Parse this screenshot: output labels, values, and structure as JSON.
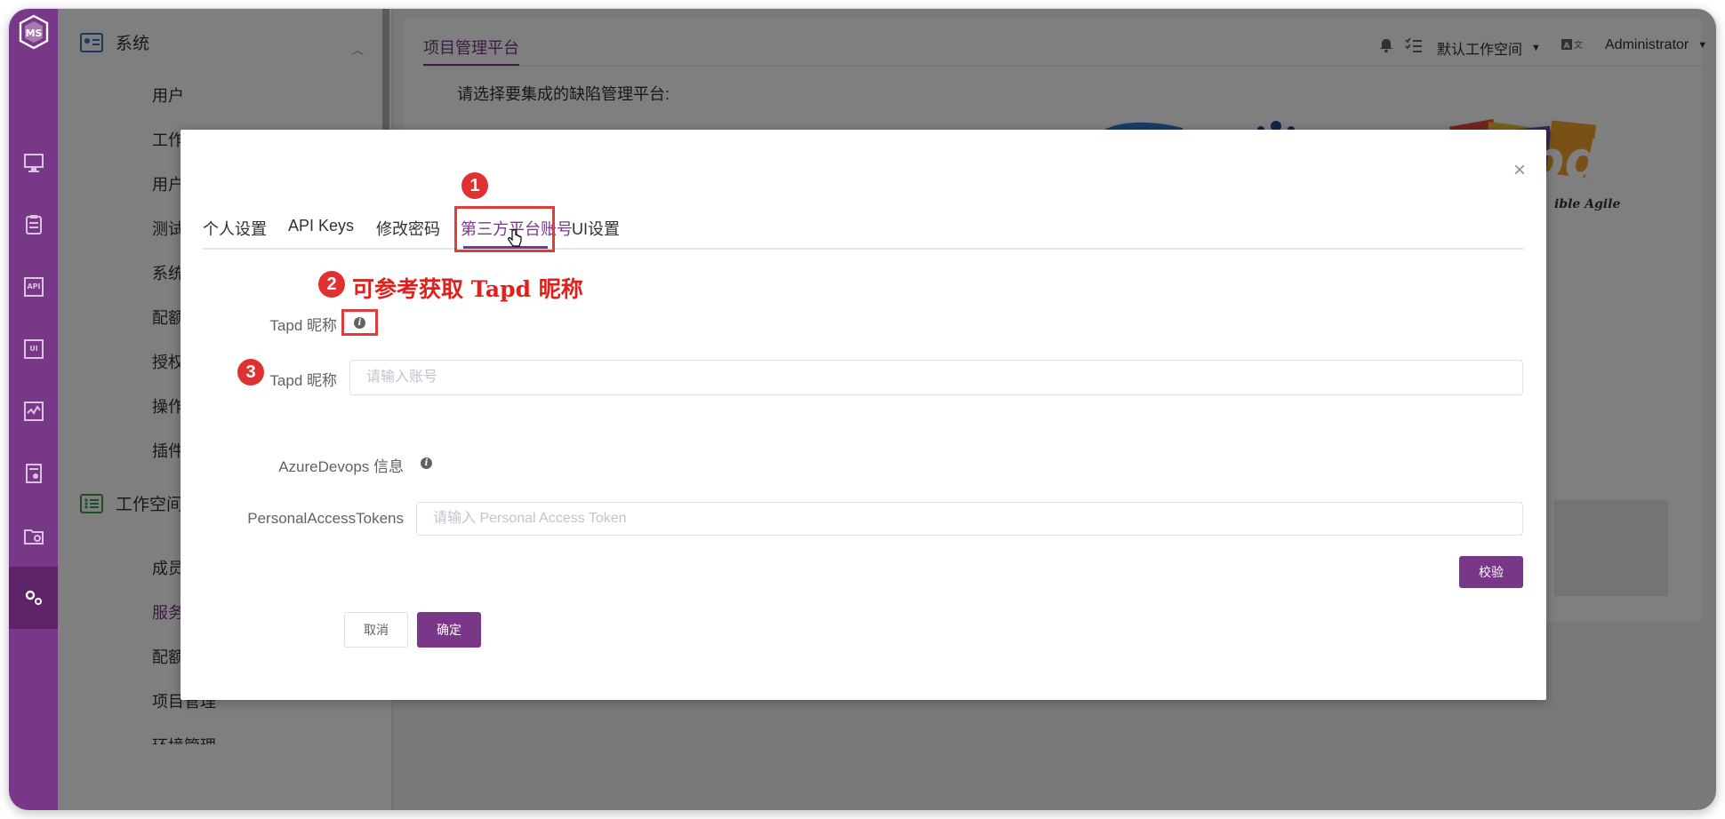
{
  "sidebar": {
    "groups": [
      {
        "label": "系统"
      },
      {
        "label": "工作空间"
      }
    ],
    "system_items": [
      "用户",
      "工作空间",
      "用户组与权",
      "测试资源池",
      "系统参数设",
      "配额管理",
      "授权管理",
      "操作日志",
      "插件管理"
    ],
    "workspace_items": [
      "成员",
      "服务集成",
      "配额管理",
      "项目管理",
      "环境管理"
    ]
  },
  "header": {
    "tab_title": "项目管理平台",
    "prompt": "请选择要集成的缺陷管理平台:",
    "workspace": "默认工作空间",
    "user": "Administrator",
    "tapd_slogan": "ible Agile"
  },
  "dialog": {
    "tabs": [
      "个人设置",
      "API Keys",
      "修改密码",
      "第三方平台账号",
      "UI设置"
    ],
    "active_tab": 3,
    "annotation": "可参考获取 Tapd 昵称",
    "badges": [
      "1",
      "2",
      "3"
    ],
    "tapd_label_1": "Tapd 昵称",
    "tapd_label_2": "Tapd 昵称",
    "tapd_placeholder": "请输入账号",
    "azure_label": "AzureDevops 信息",
    "pat_label": "PersonalAccessTokens",
    "pat_placeholder": "请输入 Personal Access Token",
    "verify_button": "校验",
    "cancel_button": "取消",
    "confirm_button": "确定"
  },
  "colors": {
    "primary": "#783887",
    "annotation_red": "#e0201c"
  }
}
